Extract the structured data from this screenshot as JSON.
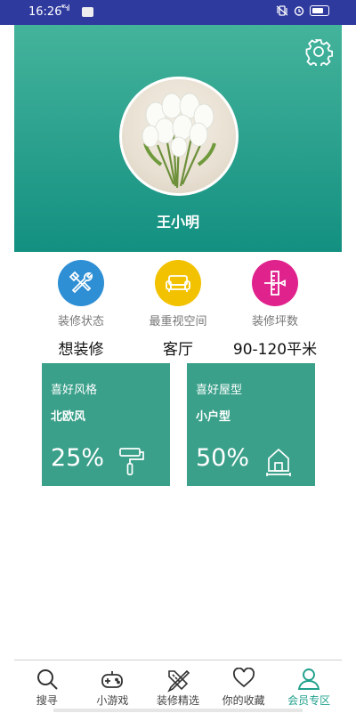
{
  "statusbar": {
    "time": "16:26",
    "network": "⁴⁶ᐧıl"
  },
  "profile": {
    "username": "王小明"
  },
  "stats": [
    {
      "label": "装修状态",
      "value": "想装修",
      "icon": "tools-icon",
      "color": "#2f8fd4"
    },
    {
      "label": "最重视空间",
      "value": "客厅",
      "icon": "sofa-icon",
      "color": "#f2c200"
    },
    {
      "label": "装修坪数",
      "value": "90-120平米",
      "icon": "ruler-pencil-icon",
      "color": "#e0228c"
    }
  ],
  "cards": [
    {
      "title": "喜好风格",
      "value": "北欧风",
      "percent": "25%",
      "icon": "paint-roller-icon"
    },
    {
      "title": "喜好屋型",
      "value": "小户型",
      "percent": "50%",
      "icon": "house-icon"
    }
  ],
  "nav": {
    "items": [
      {
        "label": "搜寻",
        "icon": "search-icon"
      },
      {
        "label": "小游戏",
        "icon": "gamepad-icon"
      },
      {
        "label": "装修精选",
        "icon": "design-tools-icon"
      },
      {
        "label": "你的收藏",
        "icon": "heart-icon"
      },
      {
        "label": "会员专区",
        "icon": "user-icon",
        "active": true
      }
    ]
  },
  "colors": {
    "header_top": "#44b39b",
    "header_bottom": "#139081",
    "card": "#3aa08a",
    "active": "#20a08c"
  }
}
